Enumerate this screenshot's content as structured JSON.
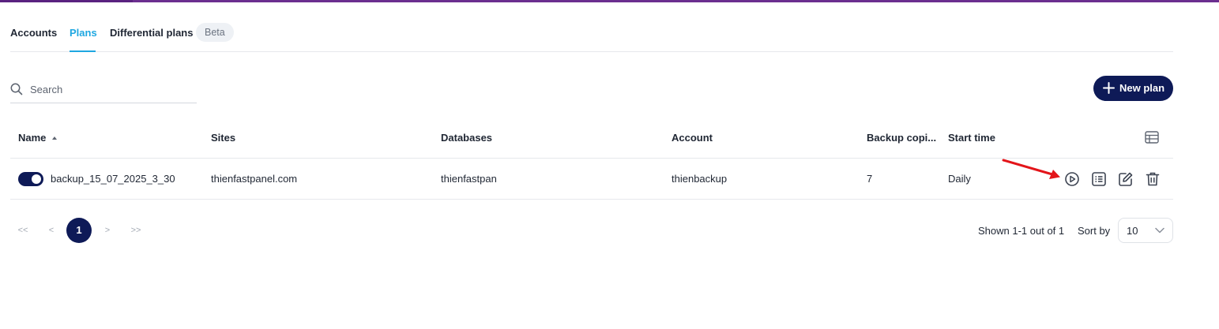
{
  "colors": {
    "accent_bar": "#6b2f8f",
    "active_tab": "#1ea7e1",
    "primary": "#0e1a57",
    "annotation_arrow": "#e3151a"
  },
  "tabs": [
    {
      "label": "Accounts",
      "active": false
    },
    {
      "label": "Plans",
      "active": true
    },
    {
      "label": "Differential plans",
      "active": false
    }
  ],
  "beta_badge": "Beta",
  "search": {
    "placeholder": "Search",
    "value": ""
  },
  "new_plan_button": "New plan",
  "table": {
    "columns": [
      "Name",
      "Sites",
      "Databases",
      "Account",
      "Backup copi...",
      "Start time"
    ],
    "sorted_column": "Name",
    "sort_direction": "ascending",
    "rows": [
      {
        "enabled": true,
        "name": "backup_15_07_2025_3_30",
        "sites": "thienfastpanel.com",
        "databases": "thienfastpan",
        "account": "thienbackup",
        "backup_copies": "7",
        "start_time": "Daily",
        "actions": [
          "play-icon",
          "list-icon",
          "edit-icon",
          "trash-icon"
        ]
      }
    ]
  },
  "pagination": {
    "first": "<<",
    "prev": "<",
    "current": "1",
    "next": ">",
    "last": ">>"
  },
  "shown_text": "Shown 1-1 out of 1",
  "sort_by_label": "Sort by",
  "sort_by_value": "10"
}
